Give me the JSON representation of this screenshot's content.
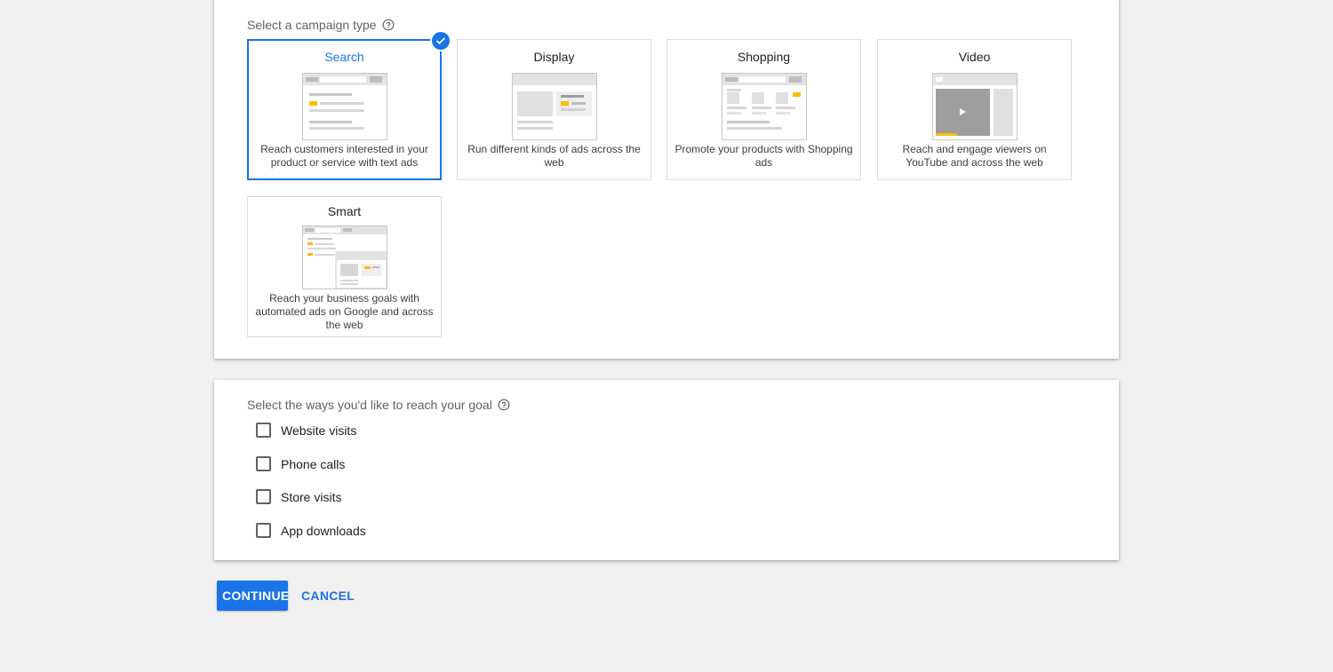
{
  "campaign_type": {
    "label": "Select a campaign type",
    "cards": [
      {
        "title": "Search",
        "description": "Reach customers interested in your product or service with text ads",
        "selected": true
      },
      {
        "title": "Display",
        "description": "Run different kinds of ads across the web",
        "selected": false
      },
      {
        "title": "Shopping",
        "description": "Promote your products with Shopping ads",
        "selected": false
      },
      {
        "title": "Video",
        "description": "Reach and engage viewers on YouTube and across the web",
        "selected": false
      },
      {
        "title": "Smart",
        "description": "Reach your business goals with automated ads on Google and across the web",
        "selected": false
      }
    ]
  },
  "goals": {
    "label": "Select the ways you'd like to reach your goal",
    "options": [
      {
        "label": "Website visits",
        "checked": false
      },
      {
        "label": "Phone calls",
        "checked": false
      },
      {
        "label": "Store visits",
        "checked": false
      },
      {
        "label": "App downloads",
        "checked": false
      }
    ]
  },
  "actions": {
    "continue_label": "CONTINUE",
    "cancel_label": "CANCEL"
  },
  "colors": {
    "accent": "#1a73e8",
    "highlight": "#fbbc04",
    "background": "#f1f1f1"
  },
  "icons": {
    "help": "help-circle-icon",
    "selected": "check-circle-icon",
    "play": "play-icon"
  }
}
